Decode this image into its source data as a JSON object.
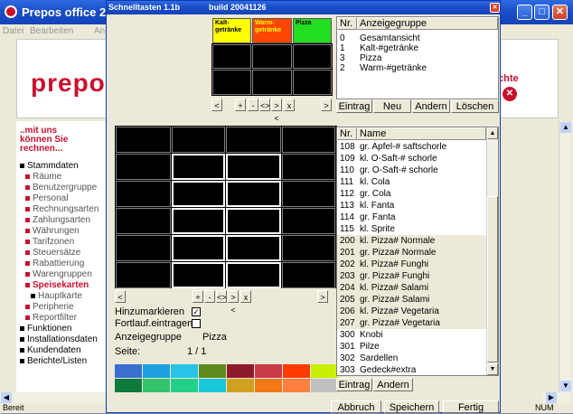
{
  "main_window": {
    "title": "Prepos office 2.",
    "menu": [
      "Datei",
      "Bearbeiten",
      "An"
    ],
    "logo": "prepo",
    "tagline": "..mit uns\nkönnen Sie\nrechnen...",
    "right_cut_text": "chte",
    "status_left": "Bereit",
    "status_right": "NUM",
    "nav": [
      {
        "label": "Stammdaten",
        "level": 0
      },
      {
        "label": "Räume",
        "level": 1
      },
      {
        "label": "Benutzergruppe",
        "level": 1
      },
      {
        "label": "Personal",
        "level": 1
      },
      {
        "label": "Rechnungsarten",
        "level": 1
      },
      {
        "label": "Zahlungsarten",
        "level": 1
      },
      {
        "label": "Währungen",
        "level": 1
      },
      {
        "label": "Tarifzonen",
        "level": 1
      },
      {
        "label": "Steuersätze",
        "level": 1
      },
      {
        "label": "Rabattierung",
        "level": 1
      },
      {
        "label": "Warengruppen",
        "level": 1
      },
      {
        "label": "Speisekarten",
        "level": 1,
        "active": true
      },
      {
        "label": "Hauptkarte",
        "level": 2
      },
      {
        "label": "Peripherie",
        "level": 1
      },
      {
        "label": "Reportfilter",
        "level": 1
      },
      {
        "label": "Funktionen",
        "level": 0
      },
      {
        "label": "Installationsdaten",
        "level": 0
      },
      {
        "label": "Kundendaten",
        "level": 0
      },
      {
        "label": "Berichte/Listen",
        "level": 0
      }
    ]
  },
  "dialog": {
    "title": "Schnelltasten 1.1b",
    "build": "build 20041126",
    "top_tabs": [
      {
        "label": "Kalt-\ngetränke",
        "color": "#ffff00",
        "text_color": "#000000"
      },
      {
        "label": "Warm-\ngetränke",
        "color": "#ff4500",
        "text_color": "#ffff00"
      },
      {
        "label": "Pizza",
        "color": "#22dd22",
        "text_color": "#000000"
      }
    ],
    "nav_buttons": [
      "<",
      "+",
      "-",
      "<>",
      "><",
      "x",
      ">"
    ],
    "group_list": {
      "headers": [
        "Nr.",
        "Anzeigegruppe"
      ],
      "rows": [
        {
          "nr": "0",
          "name": "Gesamtansicht"
        },
        {
          "nr": "1",
          "name": "Kalt-#getränke"
        },
        {
          "nr": "3",
          "name": "Pizza"
        },
        {
          "nr": "2",
          "name": "Warm-#getränke"
        }
      ],
      "buttons": [
        "Eintrag",
        "Neu",
        "Andern",
        "Löschen"
      ]
    },
    "checkboxes": [
      {
        "label": "Hinzumarkieren",
        "checked": true
      },
      {
        "label": "Fortlauf.eintragen",
        "checked": false
      }
    ],
    "info": {
      "group_label": "Anzeigegruppe",
      "group_value": "Pizza",
      "page_label": "Seite:",
      "page_value": "1 / 1"
    },
    "palette_row1": [
      "#3a6fd0",
      "#1fa0e0",
      "#29c3e8",
      "#5e8a1e",
      "#8e1a2b",
      "#c83c4a",
      "#ff3b00",
      "#c8f000"
    ],
    "palette_row2": [
      "#0e7a3c",
      "#33c36b",
      "#22d08a",
      "#18c8d8",
      "#d0a020",
      "#f07818",
      "#ff8040",
      "#c0c0c0"
    ],
    "article_list": {
      "headers": [
        "Nr.",
        "Name"
      ],
      "rows": [
        {
          "nr": "108",
          "name": "gr. Apfel-# saftschorle",
          "sel": false
        },
        {
          "nr": "109",
          "name": "kl. O-Saft-# schorle",
          "sel": false
        },
        {
          "nr": "110",
          "name": "gr. O-Saft-# schorle",
          "sel": false
        },
        {
          "nr": "111",
          "name": "kl. Cola",
          "sel": false
        },
        {
          "nr": "112",
          "name": "gr. Cola",
          "sel": false
        },
        {
          "nr": "113",
          "name": "kl. Fanta",
          "sel": false
        },
        {
          "nr": "114",
          "name": "gr. Fanta",
          "sel": false
        },
        {
          "nr": "115",
          "name": "kl. Sprite",
          "sel": false
        },
        {
          "nr": "200",
          "name": "kl. Pizza# Normale",
          "sel": true
        },
        {
          "nr": "201",
          "name": "gr. Pizza# Normale",
          "sel": true
        },
        {
          "nr": "202",
          "name": "kl. Pizza# Funghi",
          "sel": true
        },
        {
          "nr": "203",
          "name": "gr. Pizza# Funghi",
          "sel": true
        },
        {
          "nr": "204",
          "name": "kl. Pizza# Salami",
          "sel": true
        },
        {
          "nr": "205",
          "name": "gr. Pizza# Salami",
          "sel": true
        },
        {
          "nr": "206",
          "name": "kl. Pizza# Vegetaria",
          "sel": true
        },
        {
          "nr": "207",
          "name": "gr. Pizza# Vegetaria",
          "sel": true
        },
        {
          "nr": "300",
          "name": "Knobi",
          "sel": false
        },
        {
          "nr": "301",
          "name": "Pilze",
          "sel": false
        },
        {
          "nr": "302",
          "name": "Sardellen",
          "sel": false
        },
        {
          "nr": "303",
          "name": "Gedeck#extra",
          "sel": false
        }
      ],
      "buttons": [
        "Eintrag",
        "Andern"
      ]
    },
    "footer_buttons": [
      "Abbruch",
      "Speichern",
      "Fertig"
    ]
  }
}
